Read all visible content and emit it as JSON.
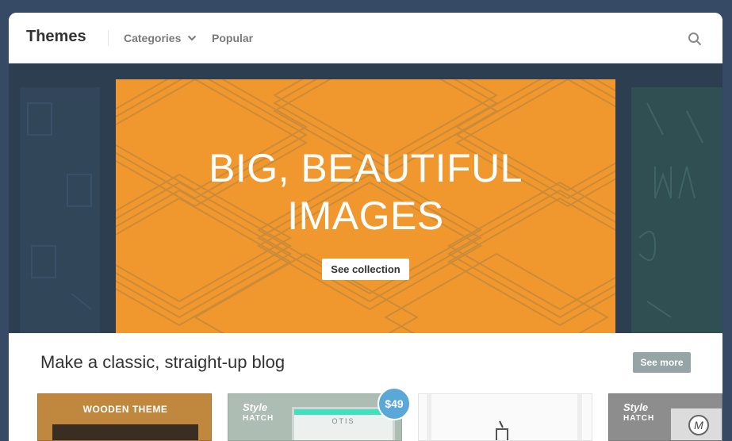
{
  "header": {
    "title": "Themes",
    "nav": [
      {
        "label": "Categories",
        "icon": "chevron-down-icon"
      },
      {
        "label": "Popular"
      }
    ],
    "search_icon": "search-icon"
  },
  "hero": {
    "title_line1": "BIG, BEAUTIFUL",
    "title_line2": "IMAGES",
    "button_label": "See collection",
    "background_color": "#f0982e"
  },
  "section": {
    "title": "Make a classic, straight-up blog",
    "see_more_label": "See more"
  },
  "cards": [
    {
      "label": "WOODEN THEME"
    },
    {
      "logo_line1": "Style",
      "logo_line2": "HATCH",
      "screen_text": "OTIS",
      "price": "$49"
    },
    {},
    {
      "logo_line1": "Style",
      "logo_line2": "HATCH",
      "badge": "M"
    }
  ],
  "colors": {
    "page_bg": "#364a66",
    "hero_bg": "#2d3e50",
    "see_more_bg": "#95a5a6",
    "price_badge": "#5aa8d8"
  }
}
